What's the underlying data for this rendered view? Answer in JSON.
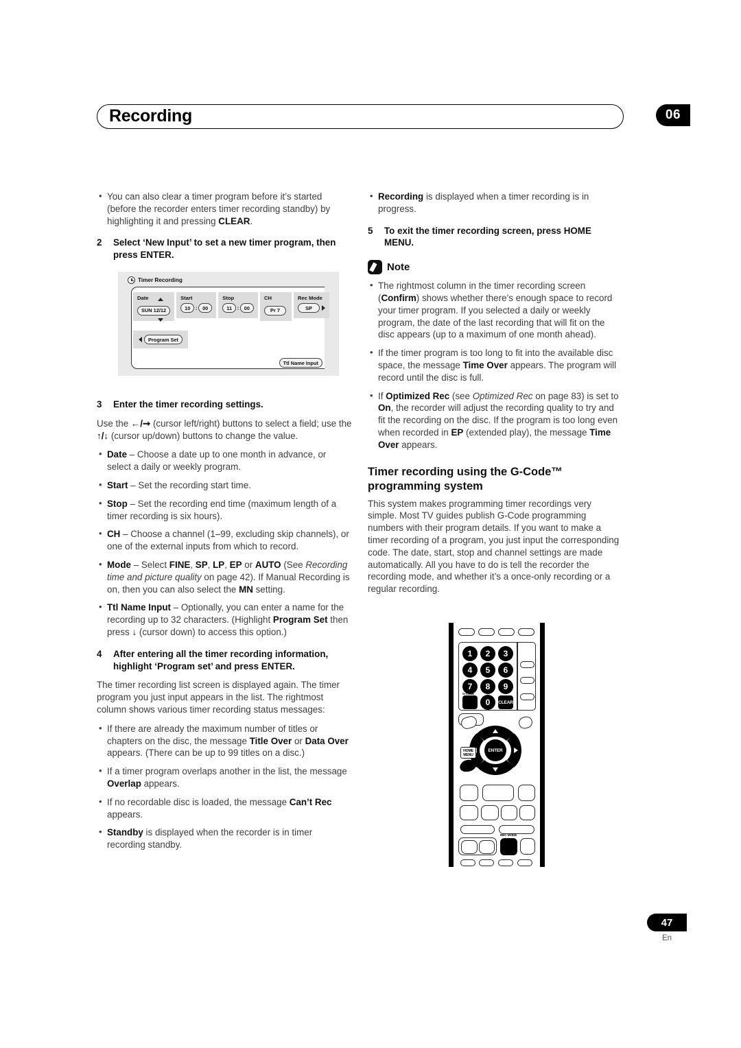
{
  "header": {
    "title": "Recording",
    "chapter": "06"
  },
  "footer": {
    "page_number": "47",
    "language": "En"
  },
  "left_column": {
    "bullet_clear": "You can also clear a timer program before it’s started (before the recorder enters timer recording standby) by highlighting it and pressing CLEAR.",
    "step2_num": "2",
    "step2_text": "Select ‘New Input’ to set a new timer program, then press ENTER.",
    "step3_num": "3",
    "step3_text": "Enter the timer recording settings.",
    "step3_body": "Use the ←/→ (cursor left/right) buttons to select a field; use the ↑/↓ (cursor up/down) buttons to change the value.",
    "bullets": [
      "Date – Choose a date up to one month in advance, or select a daily or weekly program.",
      "Start – Set the recording start time.",
      "Stop – Set the recording end time (maximum length of a timer recording is six hours).",
      "CH – Choose a channel (1–99, excluding skip channels), or one of the external inputs from which to record.",
      "Mode – Select FINE, SP, LP, EP or AUTO (See Recording time and picture quality on page 42). If Manual Recording is on, then you can also select the MN setting.",
      "Ttl Name Input – Optionally, you can enter a name for the recording up to 32 characters. (Highlight Program Set then press ↓ (cursor down) to access this option.)"
    ],
    "step4_num": "4",
    "step4_text": "After entering all the timer recording information, highlight ‘Program set’ and press ENTER.",
    "step4_body": "The timer recording list screen is displayed again. The timer program you just input appears in the list. The rightmost column shows various timer recording status messages:",
    "status_bullets": [
      "If there are already the maximum number of titles or chapters on the disc, the message Title Over or Data Over appears. (There can be up to 99 titles on a disc.)",
      "If a timer program overlaps another in the list, the message Overlap appears.",
      "If no recordable disc is loaded, the message Can’t Rec appears.",
      "Standby is displayed when the recorder is in timer recording standby."
    ]
  },
  "osd_figure": {
    "title": "Timer Recording",
    "fields": [
      {
        "label": "Date",
        "value": "SUN 12/12"
      },
      {
        "label": "Start",
        "value_h": "10",
        "value_m": "00"
      },
      {
        "label": "Stop",
        "value_h": "11",
        "value_m": "00"
      },
      {
        "label": "CH",
        "value": "Pr 7"
      },
      {
        "label": "Rec Mode",
        "value": "SP"
      }
    ],
    "program_set_label": "Program Set",
    "ttl_name_label": "Ttl Name Input"
  },
  "right_column": {
    "bullet_recording": "Recording is displayed when a timer recording is in progress.",
    "step5_num": "5",
    "step5_text": "To exit the timer recording screen, press HOME MENU.",
    "note_label": "Note",
    "note_bullets": [
      "The rightmost column in the timer recording screen (Confirm) shows whether there’s enough space to record your timer program. If you selected a daily or weekly program, the date of the last recording that will fit on the disc appears (up to a maximum of one month ahead).",
      "If the timer program is too long to fit into the available disc space, the message Time Over appears. The program will record until the disc is full.",
      "If Optimized Rec (see Optimized Rec on page 83) is set to On, the recorder will adjust the recording quality to try and fit the recording on the disc. If the program is too long even when recorded in EP (extended play), the message Time Over appears."
    ],
    "section_heading": "Timer recording using the G-Code™ programming system",
    "section_body": "This system makes programming timer recordings very simple. Most TV guides publish G-Code programming numbers with their program details. If you want to make a timer recording of a program, you just input the corresponding code. The date, start, stop and channel settings are made automatically. All you have to do is tell the recorder the recording mode, and whether it’s a once-only recording or a regular recording."
  },
  "remote": {
    "keys": [
      "1",
      "2",
      "3",
      "4",
      "5",
      "6",
      "7",
      "8",
      "9",
      "0"
    ],
    "clear_label": "CLEAR",
    "gcode_label": "G-CODE",
    "enter_label": "ENTER",
    "home_menu_label_1": "HOME",
    "home_menu_label_2": "MENU",
    "rec_mode_label": "REC MODE"
  }
}
